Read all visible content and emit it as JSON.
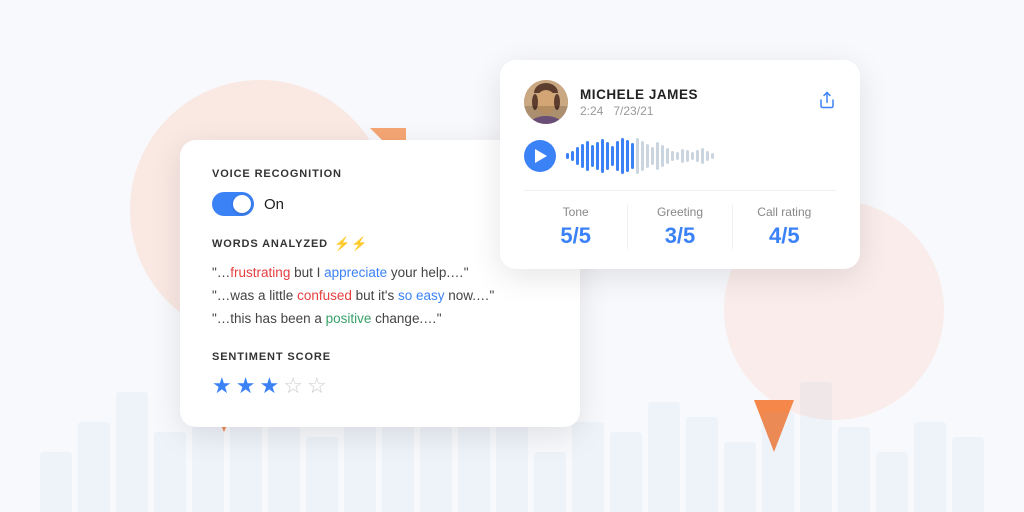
{
  "background": {
    "bars": [
      60,
      90,
      120,
      80,
      100,
      140,
      110,
      75,
      95,
      130,
      85,
      105,
      120,
      60,
      90,
      80,
      110,
      95,
      70,
      100,
      130,
      85,
      60,
      90,
      75
    ]
  },
  "voice_card": {
    "title": "VOICE RECOGNITION",
    "toggle_label": "On",
    "toggle_on": true,
    "words_section_title": "WORDS ANALYZED",
    "quotes": [
      {
        "id": 1,
        "parts": [
          {
            "text": "\"…",
            "type": "normal"
          },
          {
            "text": "frustrating",
            "type": "red"
          },
          {
            "text": " but I ",
            "type": "normal"
          },
          {
            "text": "appreciate",
            "type": "blue"
          },
          {
            "text": " your help.…\"",
            "type": "normal"
          }
        ]
      },
      {
        "id": 2,
        "parts": [
          {
            "text": "\"…was a little ",
            "type": "normal"
          },
          {
            "text": "confused",
            "type": "red"
          },
          {
            "text": " but it's ",
            "type": "normal"
          },
          {
            "text": "so easy",
            "type": "blue"
          },
          {
            "text": " now.…\"",
            "type": "normal"
          }
        ]
      },
      {
        "id": 3,
        "parts": [
          {
            "text": "\"…this has been a ",
            "type": "normal"
          },
          {
            "text": "positive",
            "type": "green"
          },
          {
            "text": " change.…\"",
            "type": "normal"
          }
        ]
      }
    ],
    "sentiment_section_title": "SENTIMENT SCORE",
    "stars_filled": 3,
    "stars_empty": 2
  },
  "call_card": {
    "name": "MICHELE JAMES",
    "duration": "2:24",
    "date": "7/23/21",
    "metrics": [
      {
        "label": "Tone",
        "value": "5/5"
      },
      {
        "label": "Greeting",
        "value": "3/5"
      },
      {
        "label": "Call rating",
        "value": "4/5"
      }
    ]
  }
}
